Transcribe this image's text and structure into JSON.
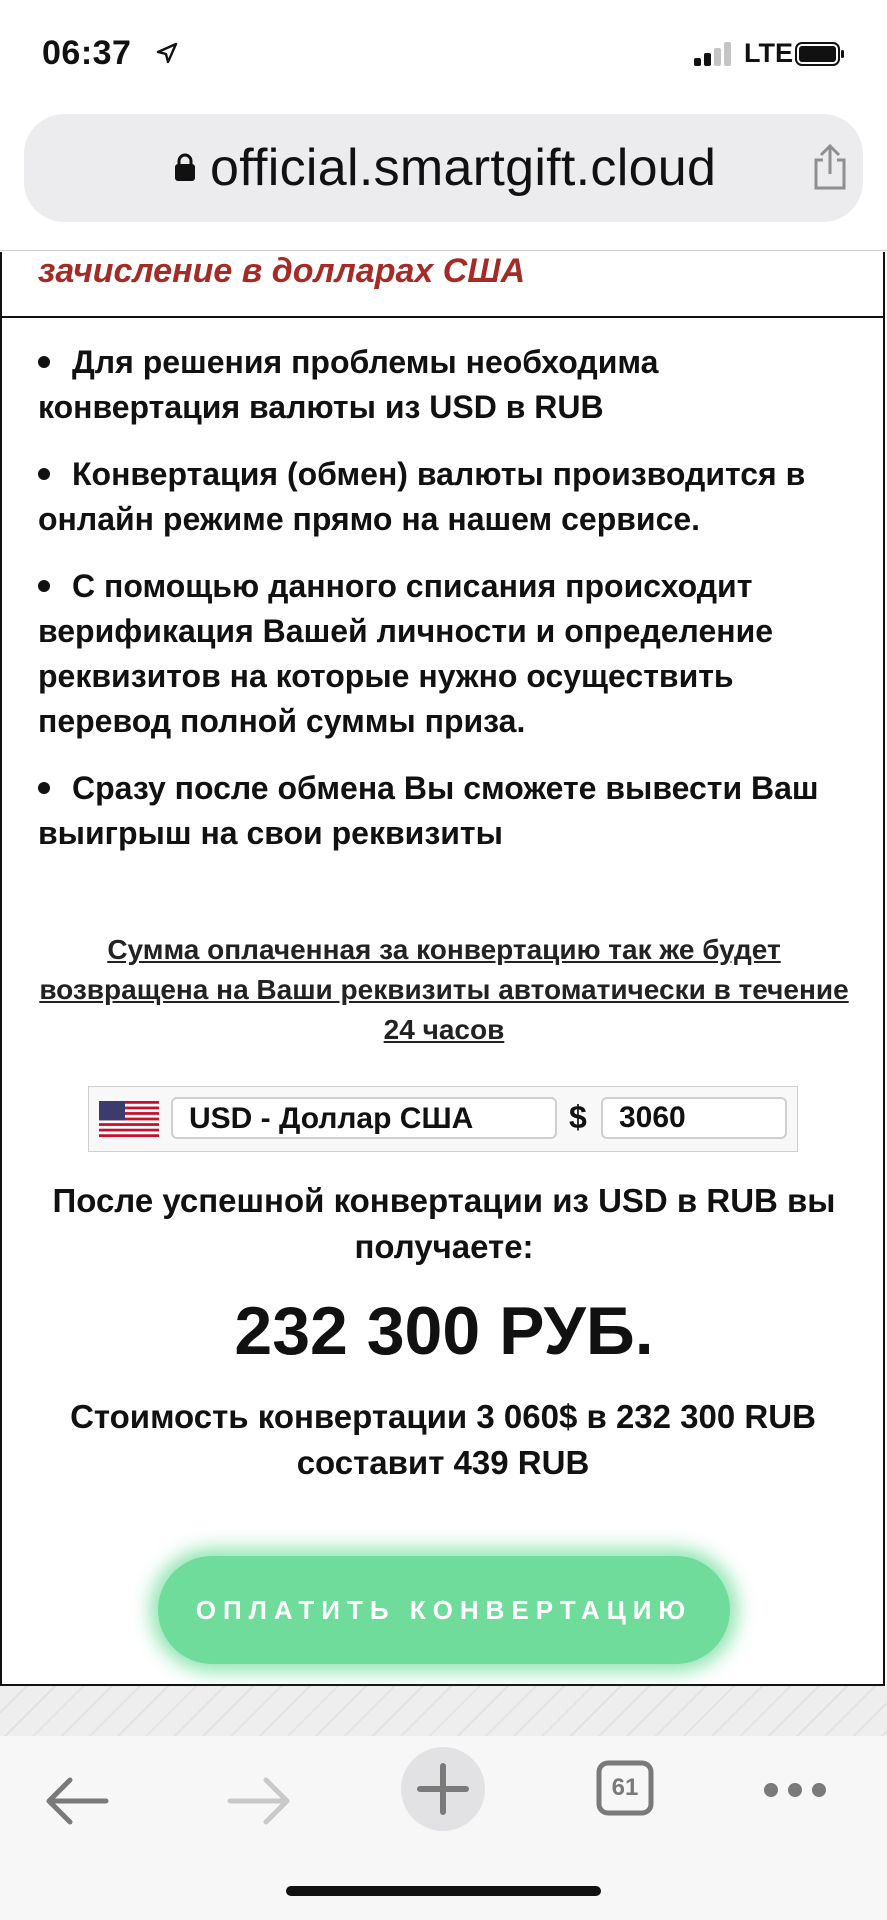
{
  "status_bar": {
    "time": "06:37",
    "network": "LTE",
    "icons": [
      "location-arrow-icon",
      "signal-bars-icon",
      "battery-icon"
    ]
  },
  "browser": {
    "url": "official.smartgift.cloud",
    "icons": [
      "lock-icon",
      "share-icon"
    ]
  },
  "content": {
    "top_heading": "зачисление в долларах США",
    "bullets": [
      "Для решения проблемы необходима конвертация валюты из USD в RUB",
      "Конвертация (обмен) валюты производится в онлайн режиме прямо на нашем сервисе.",
      "С помощью данного списания происходит верификация Вашей личности и определение реквизитов на которые нужно осуществить перевод полной суммы приза.",
      "Сразу после обмена Вы сможете вывести Ваш выигрыш на свои реквизиты"
    ],
    "notice": "Сумма оплаченная за конвертацию так же будет возвращена на Ваши реквизиты автоматически в течение 24 часов",
    "converter": {
      "flag_icon": "us-flag-icon",
      "currency_selected": "USD - Доллар США",
      "currency_symbol": "$",
      "amount_value": "3060"
    },
    "after_text": "После успешной конвертации из USD в RUB вы получаете:",
    "big_amount": "232 300 РУБ.",
    "cost_text": "Стоимость конвертации 3 060$ в 232 300 RUB составит 439 RUB",
    "pay_button": "ОПЛАТИТЬ КОНВЕРТАЦИЮ",
    "accent_color": "#a52b26",
    "button_color": "#6fdc9c"
  },
  "toolbar": {
    "tabs_count": "61",
    "icons": [
      "back-arrow-icon",
      "forward-arrow-icon",
      "new-tab-plus-icon",
      "tabs-icon",
      "more-icon"
    ]
  }
}
